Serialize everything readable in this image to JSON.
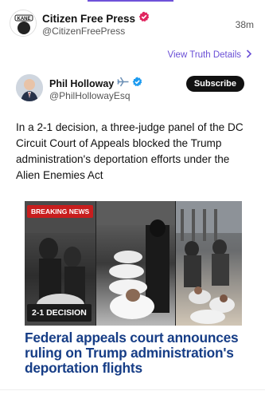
{
  "post": {
    "author_name": "Citizen Free Press",
    "author_handle": "@CitizenFreePress",
    "time": "38m",
    "view_truth_label": "View Truth Details",
    "avatar_logo_text": "KANE"
  },
  "quoted": {
    "author_name": "Phil Holloway",
    "author_handle": "@PhilHollowayEsq",
    "subscribe_label": "Subscribe",
    "text": "In a 2-1 decision, a three-judge panel of the DC Circuit Court of Appeals blocked the Trump administration's deportation efforts under the Alien Enemies Act"
  },
  "media": {
    "breaking_label": "BREAKING NEWS",
    "decision_label": "2-1 DECISION",
    "headline": "Federal appeals court announces ruling on Trump administration's deportation flights"
  },
  "colors": {
    "accent_purple": "#6a4fd6",
    "verified_pink": "#e0245e",
    "verified_blue": "#1d9bf0",
    "headline_blue": "#163d86",
    "breaking_red": "#c81e1e"
  },
  "icons": [
    "verified-badge-icon",
    "plane-icon",
    "chevron-right-icon"
  ]
}
